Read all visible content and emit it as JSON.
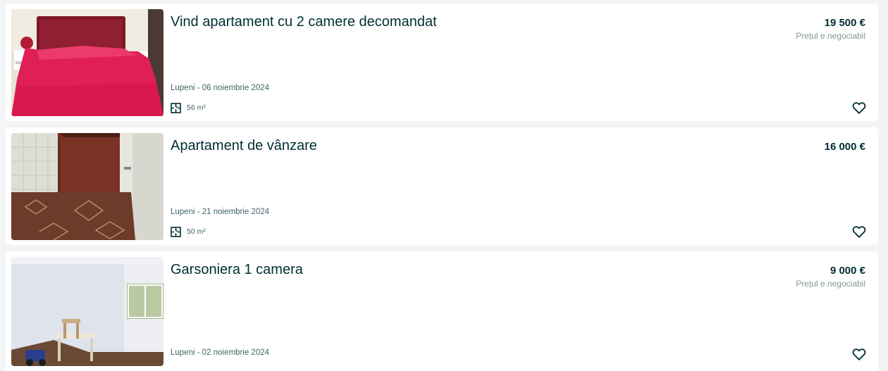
{
  "listings": [
    {
      "title": "Vind apartament cu 2 camere decomandat",
      "price": "19 500 €",
      "negotiable": "Prețul e negociabil",
      "location_date": "Lupeni - 06 noiembrie 2024",
      "area": "56 m²",
      "photo": "bedroom-with-red-bedspread",
      "favorite_icon": "heart-outline-icon",
      "area_icon": "floorplan-icon"
    },
    {
      "title": "Apartament de vânzare",
      "price": "16 000 €",
      "location_date": "Lupeni - 21 noiembrie 2024",
      "area": "50 m²",
      "photo": "room-with-patterned-floor-and-door",
      "favorite_icon": "heart-outline-icon",
      "area_icon": "floorplan-icon"
    },
    {
      "title": "Garsoniera 1 camera",
      "price": "9 000 €",
      "negotiable": "Prețul e negociabil",
      "location_date": "Lupeni - 02 noiembrie 2024",
      "photo": "empty-room-with-stool-and-window",
      "favorite_icon": "heart-outline-icon"
    }
  ],
  "colors": {
    "page_bg": "#f2f4f5",
    "card_bg": "#ffffff",
    "text_primary": "#002f34",
    "text_secondary": "#406367",
    "text_muted": "#7f9799"
  }
}
